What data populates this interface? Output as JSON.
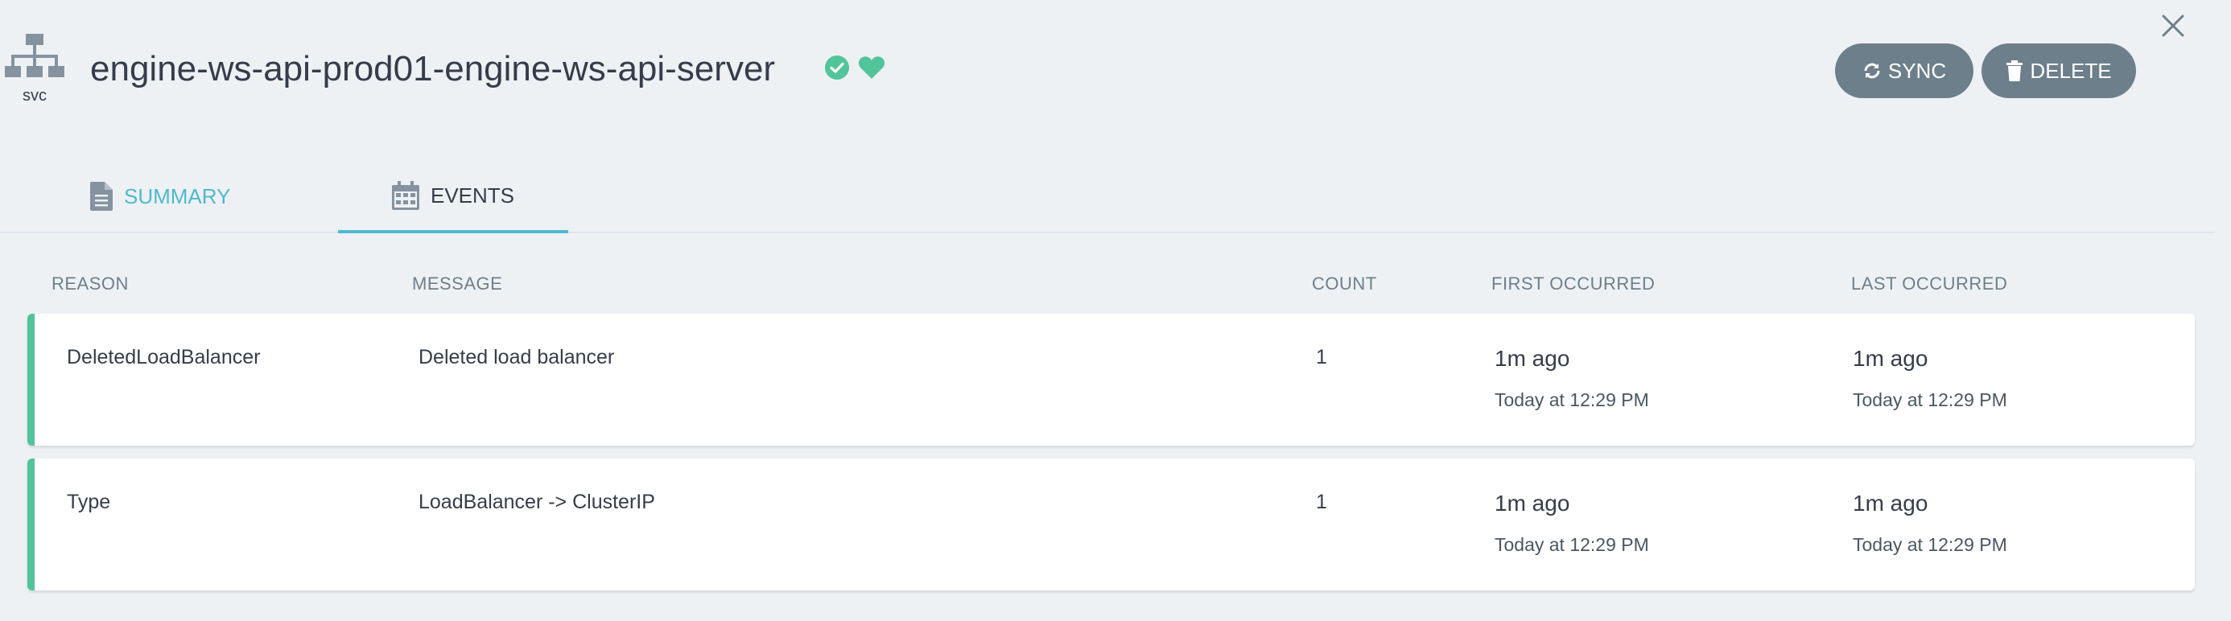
{
  "resource": {
    "kind": "svc",
    "name": "engine-ws-api-prod01-engine-ws-api-server",
    "sync_status_icon": "check-circle-icon",
    "health_status_icon": "heart-icon",
    "status_color": "#52c49a"
  },
  "actions": {
    "sync_label": "SYNC",
    "delete_label": "DELETE"
  },
  "tabs": [
    {
      "label": "SUMMARY",
      "icon": "file-icon",
      "active": false
    },
    {
      "label": "EVENTS",
      "icon": "calendar-icon",
      "active": true
    }
  ],
  "events": {
    "columns": [
      "REASON",
      "MESSAGE",
      "COUNT",
      "FIRST OCCURRED",
      "LAST OCCURRED"
    ],
    "rows": [
      {
        "reason": "DeletedLoadBalancer",
        "message": "Deleted load balancer",
        "count": "1",
        "first_relative": "1m ago",
        "first_absolute": "Today at 12:29 PM",
        "last_relative": "1m ago",
        "last_absolute": "Today at 12:29 PM"
      },
      {
        "reason": "Type",
        "message": "LoadBalancer -> ClusterIP",
        "count": "1",
        "first_relative": "1m ago",
        "first_absolute": "Today at 12:29 PM",
        "last_relative": "1m ago",
        "last_absolute": "Today at 12:29 PM"
      }
    ]
  },
  "colors": {
    "accent": "#4fb8cf",
    "button": "#6d7f8b",
    "success": "#52c49a",
    "background": "#eef1f4"
  }
}
